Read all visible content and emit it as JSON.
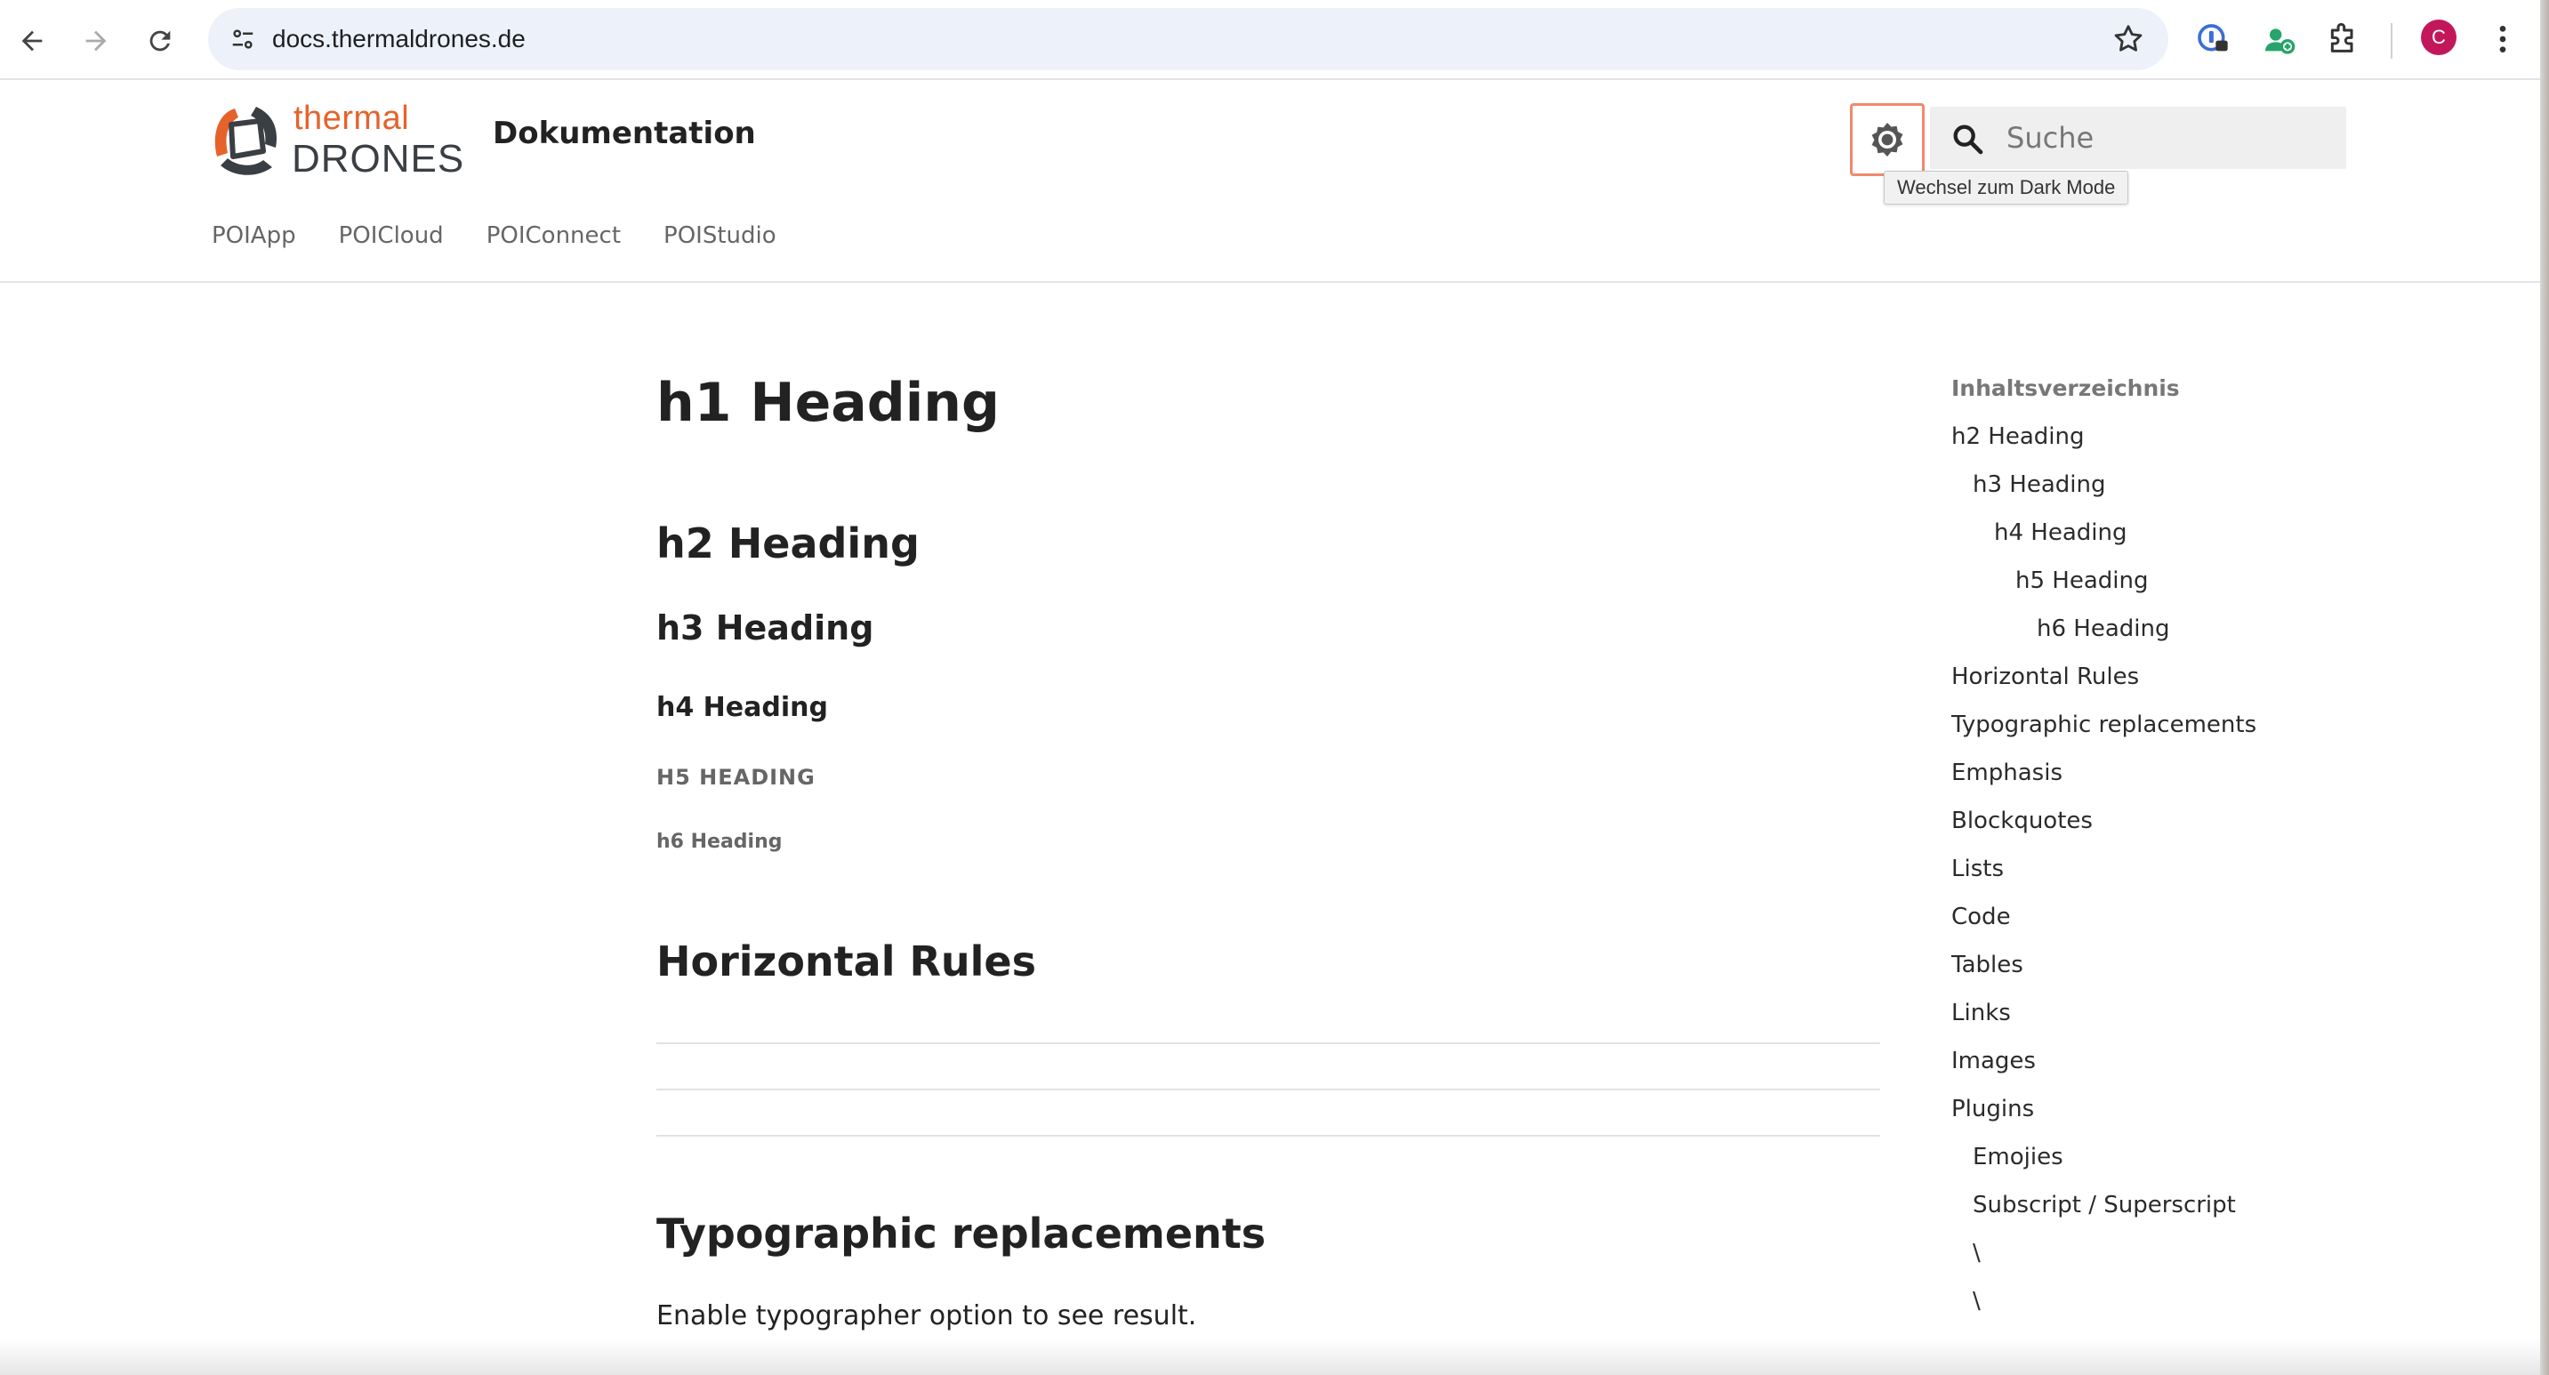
{
  "browser": {
    "url": "docs.thermaldrones.de",
    "avatar_initial": "C"
  },
  "site": {
    "logo_line1": "thermal",
    "logo_line2": "DRONES",
    "title": "Dokumentation",
    "search_placeholder": "Suche",
    "darkmode_tooltip": "Wechsel zum Dark Mode",
    "brand_color": "#e5632b"
  },
  "subnav": [
    "POIApp",
    "POICloud",
    "POIConnect",
    "POIStudio"
  ],
  "content": {
    "h1": "h1 Heading",
    "h2": "h2 Heading",
    "h3": "h3 Heading",
    "h4": "h4 Heading",
    "h5": "H5 HEADING",
    "h6": "h6 Heading",
    "section_rules": "Horizontal Rules",
    "section_typo": "Typographic replacements",
    "typo_text": "Enable typographer option to see result."
  },
  "toc": {
    "title": "Inhaltsverzeichnis",
    "items": [
      {
        "label": "h2 Heading",
        "level": 0
      },
      {
        "label": "h3 Heading",
        "level": 1
      },
      {
        "label": "h4 Heading",
        "level": 2
      },
      {
        "label": "h5 Heading",
        "level": 3
      },
      {
        "label": "h6 Heading",
        "level": 4
      },
      {
        "label": "Horizontal Rules",
        "level": 0
      },
      {
        "label": "Typographic replacements",
        "level": 0
      },
      {
        "label": "Emphasis",
        "level": 0
      },
      {
        "label": "Blockquotes",
        "level": 0
      },
      {
        "label": "Lists",
        "level": 0
      },
      {
        "label": "Code",
        "level": 0
      },
      {
        "label": "Tables",
        "level": 0
      },
      {
        "label": "Links",
        "level": 0
      },
      {
        "label": "Images",
        "level": 0
      },
      {
        "label": "Plugins",
        "level": 0
      },
      {
        "label": "Emojies",
        "level": 1
      },
      {
        "label": "Subscript / Superscript",
        "level": 1
      },
      {
        "label": "\\",
        "level": 1
      },
      {
        "label": "\\",
        "level": 1
      }
    ]
  }
}
